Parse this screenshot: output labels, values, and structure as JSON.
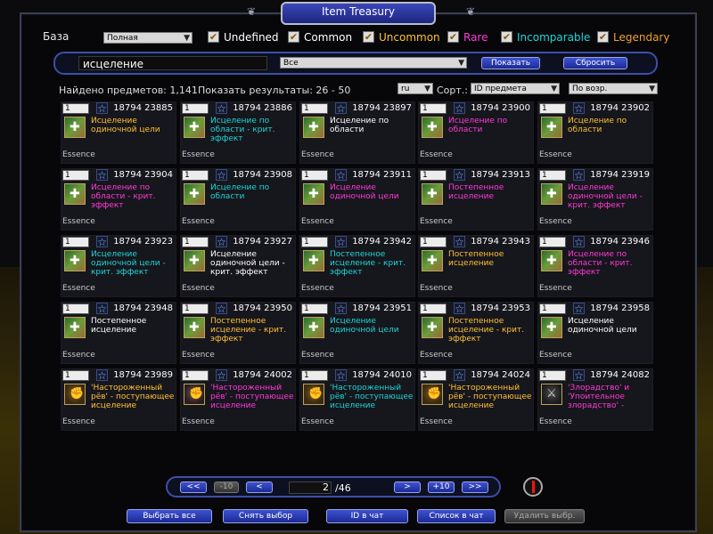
{
  "window": {
    "title": "Item Treasury"
  },
  "filters": {
    "base_label": "База",
    "base_value": "Полная",
    "qualities": [
      {
        "label": "Undefined",
        "checked": true,
        "color": "#ffffff"
      },
      {
        "label": "Common",
        "checked": true,
        "color": "#ffffff"
      },
      {
        "label": "Uncommon",
        "checked": true,
        "color": "#ffc234"
      },
      {
        "label": "Rare",
        "checked": true,
        "color": "#ff3ad6"
      },
      {
        "label": "Incomparable",
        "checked": true,
        "color": "#1ed6d6"
      },
      {
        "label": "Legendary",
        "checked": true,
        "color": "#f0a030"
      }
    ]
  },
  "search": {
    "query": "исцеление",
    "category": "Все",
    "show_label": "Показать",
    "reset_label": "Сбросить"
  },
  "results": {
    "found_text": "Найдено предметов: 1,141",
    "showing_text": "Показать результаты: 26 - 50",
    "lang": "ru",
    "sort_label": "Сорт.:",
    "sort_by": "ID предмета",
    "sort_dir": "По возр."
  },
  "items": [
    {
      "qty": "1",
      "ids": "18794 23885",
      "name": "Исцеление одиночной цели",
      "quality": "uncommon",
      "icon": "heal-icon",
      "category": "Essence"
    },
    {
      "qty": "1",
      "ids": "18794 23886",
      "name": "Исцеление по области - крит. эффект",
      "quality": "incomparable",
      "icon": "heal-icon",
      "category": "Essence"
    },
    {
      "qty": "1",
      "ids": "18794 23897",
      "name": "Исцеление по области",
      "quality": "common",
      "icon": "heal-icon",
      "category": "Essence"
    },
    {
      "qty": "1",
      "ids": "18794 23900",
      "name": "Исцеление по области",
      "quality": "rare",
      "icon": "heal-icon",
      "category": "Essence"
    },
    {
      "qty": "1",
      "ids": "18794 23902",
      "name": "Исцеление по области",
      "quality": "uncommon",
      "icon": "heal-icon",
      "category": "Essence"
    },
    {
      "qty": "1",
      "ids": "18794 23904",
      "name": "Исцеление по области - крит. эффект",
      "quality": "rare",
      "icon": "heal-icon",
      "category": "Essence"
    },
    {
      "qty": "1",
      "ids": "18794 23908",
      "name": "Исцеление по области",
      "quality": "incomparable",
      "icon": "heal-icon",
      "category": "Essence"
    },
    {
      "qty": "1",
      "ids": "18794 23911",
      "name": "Исцеление одиночной цели",
      "quality": "rare",
      "icon": "heal-icon",
      "category": "Essence"
    },
    {
      "qty": "1",
      "ids": "18794 23913",
      "name": "Постепенное исцеление",
      "quality": "rare",
      "icon": "heal-icon",
      "category": "Essence"
    },
    {
      "qty": "1",
      "ids": "18794 23919",
      "name": "Исцеление одиночной цели - крит. эффект",
      "quality": "rare",
      "icon": "heal-icon",
      "category": "Essence"
    },
    {
      "qty": "1",
      "ids": "18794 23923",
      "name": "Исцеление одиночной цели - крит. эффект",
      "quality": "incomparable",
      "icon": "heal-icon",
      "category": "Essence"
    },
    {
      "qty": "1",
      "ids": "18794 23927",
      "name": "Исцеление одиночной цели - крит. эффект",
      "quality": "common",
      "icon": "heal-icon",
      "category": "Essence"
    },
    {
      "qty": "1",
      "ids": "18794 23942",
      "name": "Постепенное исцеление - крит. эффект",
      "quality": "incomparable",
      "icon": "heal-icon",
      "category": "Essence"
    },
    {
      "qty": "1",
      "ids": "18794 23943",
      "name": "Постепенное исцеление",
      "quality": "uncommon",
      "icon": "heal-icon",
      "category": "Essence"
    },
    {
      "qty": "1",
      "ids": "18794 23946",
      "name": "Исцеление по области - крит. эффект",
      "quality": "rare",
      "icon": "heal-icon",
      "category": "Essence"
    },
    {
      "qty": "1",
      "ids": "18794 23948",
      "name": "Постепенное исцеление",
      "quality": "common",
      "icon": "heal-icon",
      "category": "Essence"
    },
    {
      "qty": "1",
      "ids": "18794 23950",
      "name": "Постепенное исцеление - крит. эффект",
      "quality": "uncommon",
      "icon": "heal-icon",
      "category": "Essence"
    },
    {
      "qty": "1",
      "ids": "18794 23951",
      "name": "Исцеление одиночной цели",
      "quality": "incomparable",
      "icon": "heal-icon",
      "category": "Essence"
    },
    {
      "qty": "1",
      "ids": "18794 23953",
      "name": "Постепенное исцеление - крит. эффект",
      "quality": "uncommon",
      "icon": "heal-icon",
      "category": "Essence"
    },
    {
      "qty": "1",
      "ids": "18794 23958",
      "name": "Исцеление одиночной цели",
      "quality": "common",
      "icon": "heal-icon",
      "category": "Essence"
    },
    {
      "qty": "1",
      "ids": "18794 23989",
      "name": "'Настороженный рёв' - поступающее исцеление",
      "quality": "uncommon",
      "icon": "roar-icon",
      "category": "Essence"
    },
    {
      "qty": "1",
      "ids": "18794 24002",
      "name": "'Настороженный рёв' - поступающее исцеление",
      "quality": "rare",
      "icon": "roar2-icon",
      "category": "Essence"
    },
    {
      "qty": "1",
      "ids": "18794 24010",
      "name": "'Настороженный рёв' - поступающее исцеление",
      "quality": "incomparable",
      "icon": "roar-icon",
      "category": "Essence"
    },
    {
      "qty": "1",
      "ids": "18794 24024",
      "name": "'Настороженный рёв' - поступающее исцеление",
      "quality": "uncommon",
      "icon": "roar-icon",
      "category": "Essence"
    },
    {
      "qty": "1",
      "ids": "18794 24082",
      "name": "'Злорадство' и 'Упоительное злорадство' -",
      "quality": "rare",
      "icon": "axe-icon",
      "category": "Essence"
    }
  ],
  "pager": {
    "first": "<<",
    "back10": "-10",
    "prev": "<",
    "page": "2",
    "total": "/46",
    "next": ">",
    "fwd10": "+10",
    "last": ">>"
  },
  "bottom": {
    "select_all": "Выбрать все",
    "deselect": "Снять выбор",
    "id_to_chat": "ID в чат",
    "list_to_chat": "Список в чат",
    "delete_selected": "Удалить выбр."
  }
}
